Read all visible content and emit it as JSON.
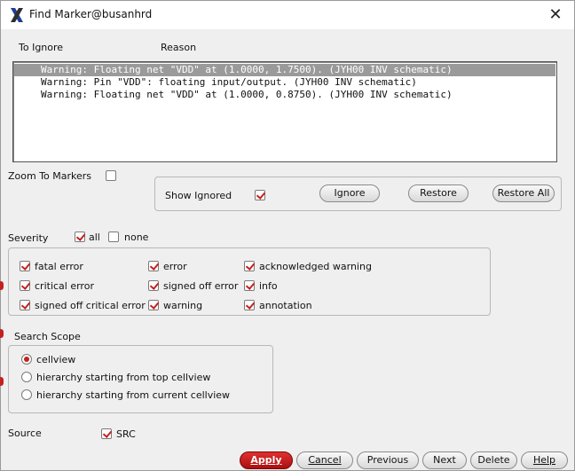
{
  "window": {
    "title": "Find Marker@busanhrd",
    "close_glyph": "✕"
  },
  "columns": {
    "to_ignore": "To Ignore",
    "reason": "Reason"
  },
  "markers": [
    {
      "text": "Warning: Floating net \"VDD\" at (1.0000, 1.7500). (JYH00 INV schematic)",
      "selected": true
    },
    {
      "text": "Warning: Pin \"VDD\": floating input/output. (JYH00 INV schematic)",
      "selected": false
    },
    {
      "text": "Warning: Floating net \"VDD\" at (1.0000, 0.8750). (JYH00 INV schematic)",
      "selected": false
    }
  ],
  "zoom_to_markers": {
    "label": "Zoom To Markers",
    "checked": false
  },
  "ignore_panel": {
    "show_ignored_label": "Show Ignored",
    "show_ignored_checked": true,
    "ignore_btn": "Ignore",
    "restore_btn": "Restore",
    "restore_all_btn": "Restore All"
  },
  "severity": {
    "label": "Severity",
    "all_label": "all",
    "all_checked": true,
    "none_label": "none",
    "none_checked": false,
    "items": {
      "fatal_error": "fatal error",
      "critical_error": "critical error",
      "signed_off_critical_error": "signed off critical error",
      "error": "error",
      "signed_off_error": "signed off error",
      "warning": "warning",
      "acknowledged_warning": "acknowledged warning",
      "info": "info",
      "annotation": "annotation"
    }
  },
  "search_scope": {
    "label": "Search Scope",
    "options": {
      "cellview": "cellview",
      "top": "hierarchy starting from top cellview",
      "current": "hierarchy starting from current cellview"
    },
    "selected": "cellview"
  },
  "source": {
    "label": "Source",
    "src_label": "SRC",
    "src_checked": true
  },
  "buttons": {
    "apply": "Apply",
    "cancel": "Cancel",
    "previous": "Previous",
    "next": "Next",
    "delete": "Delete",
    "help": "Help"
  },
  "colors": {
    "accent": "#c42020",
    "selection": "#9a9a9a",
    "background": "#efefef"
  }
}
